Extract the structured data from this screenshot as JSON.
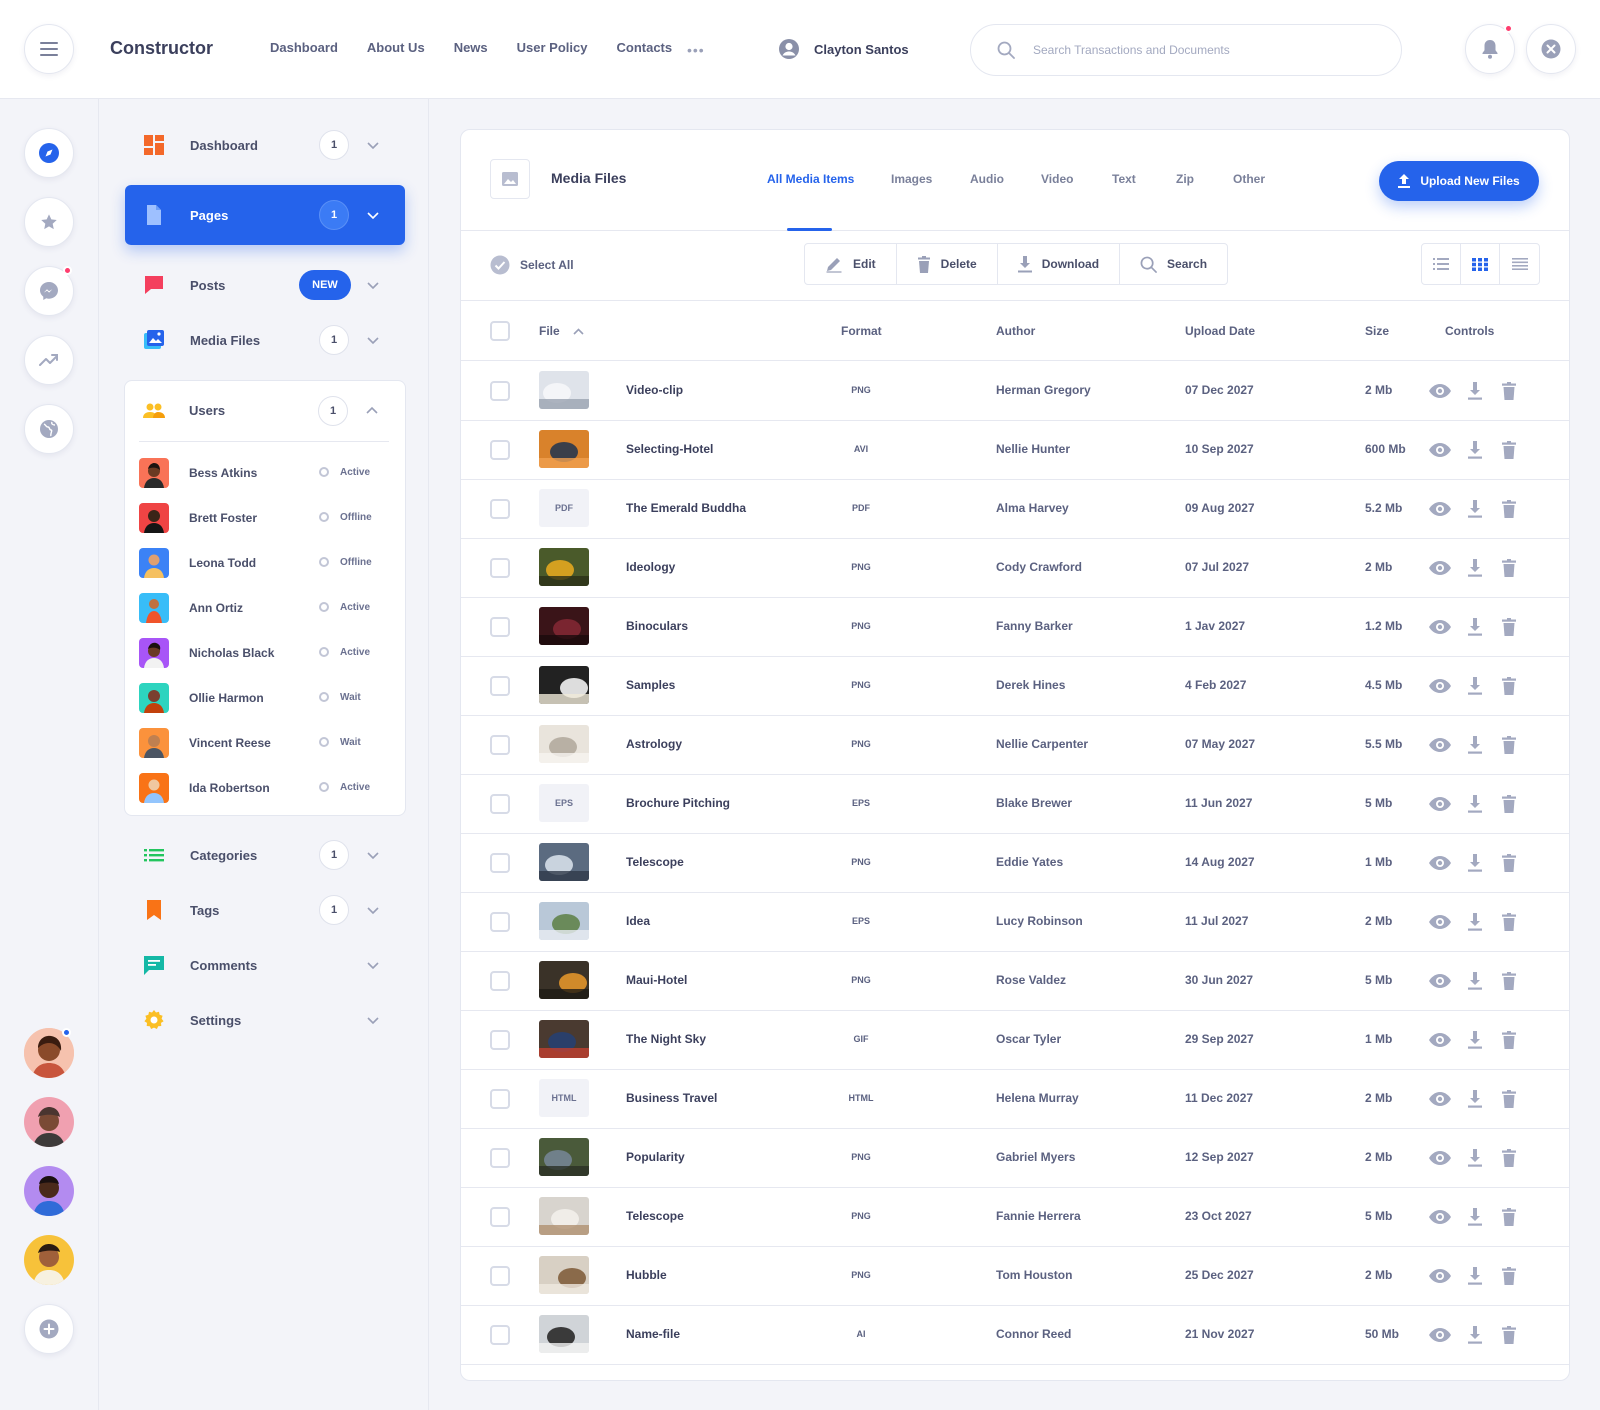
{
  "header": {
    "brand": "Constructor",
    "nav": [
      "Dashboard",
      "About Us",
      "News",
      "User Policy",
      "Contacts"
    ],
    "more": "•••",
    "user_name": "Clayton Santos",
    "search_placeholder": "Search Transactions and Documents"
  },
  "colors": {
    "accent": "#2563eb",
    "notification": "#ff3d6e"
  },
  "rail": {
    "icons": [
      "compass-icon",
      "star-icon",
      "messenger-icon",
      "trending-icon",
      "globe-icon"
    ],
    "avatars": 4,
    "add_icon": "plus-icon"
  },
  "menu": {
    "dashboard": {
      "label": "Dashboard",
      "count": "1"
    },
    "pages": {
      "label": "Pages",
      "count": "1"
    },
    "posts": {
      "label": "Posts",
      "badge": "NEW"
    },
    "media": {
      "label": "Media Files",
      "count": "1"
    },
    "users": {
      "label": "Users",
      "count": "1"
    },
    "categories": {
      "label": "Categories",
      "count": "1"
    },
    "tags": {
      "label": "Tags",
      "count": "1"
    },
    "comments": {
      "label": "Comments"
    },
    "settings": {
      "label": "Settings"
    }
  },
  "users": [
    {
      "name": "Bess Atkins",
      "status": "Active"
    },
    {
      "name": "Brett Foster",
      "status": "Offline"
    },
    {
      "name": "Leona Todd",
      "status": "Offline"
    },
    {
      "name": "Ann Ortiz",
      "status": "Active"
    },
    {
      "name": "Nicholas Black",
      "status": "Active"
    },
    {
      "name": "Ollie Harmon",
      "status": "Wait"
    },
    {
      "name": "Vincent Reese",
      "status": "Wait"
    },
    {
      "name": "Ida Robertson",
      "status": "Active"
    }
  ],
  "media": {
    "title": "Media Files",
    "tabs": [
      "All Media Items",
      "Images",
      "Audio",
      "Video",
      "Text",
      "Zip",
      "Other"
    ],
    "upload": "Upload New Files",
    "select_all": "Select All",
    "actions": [
      "Edit",
      "Delete",
      "Download",
      "Search"
    ],
    "columns": {
      "file": "File",
      "format": "Format",
      "author": "Author",
      "date": "Upload Date",
      "size": "Size",
      "controls": "Controls"
    },
    "rows": [
      {
        "name": "Video-clip",
        "format": "PNG",
        "author": "Herman Gregory",
        "date": "07 Dec 2027",
        "size": "2 Mb",
        "thumb": "img"
      },
      {
        "name": "Selecting-Hotel",
        "format": "AVI",
        "author": "Nellie Hunter",
        "date": "10 Sep 2027",
        "size": "600 Mb",
        "thumb": "img"
      },
      {
        "name": "The Emerald Buddha",
        "format": "PDF",
        "author": "Alma Harvey",
        "date": "09 Aug 2027",
        "size": "5.2 Mb",
        "thumb": "PDF"
      },
      {
        "name": "Ideology",
        "format": "PNG",
        "author": "Cody Crawford",
        "date": "07 Jul 2027",
        "size": "2 Mb",
        "thumb": "img"
      },
      {
        "name": "Binoculars",
        "format": "PNG",
        "author": "Fanny Barker",
        "date": "1 Jav 2027",
        "size": "1.2 Mb",
        "thumb": "img"
      },
      {
        "name": "Samples",
        "format": "PNG",
        "author": "Derek Hines",
        "date": "4 Feb 2027",
        "size": "4.5 Mb",
        "thumb": "img"
      },
      {
        "name": "Astrology",
        "format": "PNG",
        "author": "Nellie Carpenter",
        "date": "07 May 2027",
        "size": "5.5 Mb",
        "thumb": "img"
      },
      {
        "name": "Brochure Pitching",
        "format": "EPS",
        "author": "Blake Brewer",
        "date": "11 Jun 2027",
        "size": "5 Mb",
        "thumb": "EPS"
      },
      {
        "name": "Telescope",
        "format": "PNG",
        "author": "Eddie Yates",
        "date": "14 Aug 2027",
        "size": "1 Mb",
        "thumb": "img"
      },
      {
        "name": "Idea",
        "format": "EPS",
        "author": "Lucy Robinson",
        "date": "11 Jul 2027",
        "size": "2 Mb",
        "thumb": "img"
      },
      {
        "name": "Maui-Hotel",
        "format": "PNG",
        "author": "Rose Valdez",
        "date": "30 Jun 2027",
        "size": "5 Mb",
        "thumb": "img"
      },
      {
        "name": "The Night Sky",
        "format": "GIF",
        "author": "Oscar Tyler",
        "date": "29 Sep 2027",
        "size": "1 Mb",
        "thumb": "img"
      },
      {
        "name": "Business Travel",
        "format": "HTML",
        "author": "Helena Murray",
        "date": "11 Dec 2027",
        "size": "2 Mb",
        "thumb": "HTML"
      },
      {
        "name": "Popularity",
        "format": "PNG",
        "author": "Gabriel Myers",
        "date": "12 Sep 2027",
        "size": "2 Mb",
        "thumb": "img"
      },
      {
        "name": "Telescope",
        "format": "PNG",
        "author": "Fannie Herrera",
        "date": "23 Oct 2027",
        "size": "5 Mb",
        "thumb": "img"
      },
      {
        "name": "Hubble",
        "format": "PNG",
        "author": "Tom Houston",
        "date": "25 Dec 2027",
        "size": "2 Mb",
        "thumb": "img"
      },
      {
        "name": "Name-file",
        "format": "AI",
        "author": "Connor Reed",
        "date": "21 Nov 2027",
        "size": "50 Mb",
        "thumb": "img"
      }
    ]
  }
}
